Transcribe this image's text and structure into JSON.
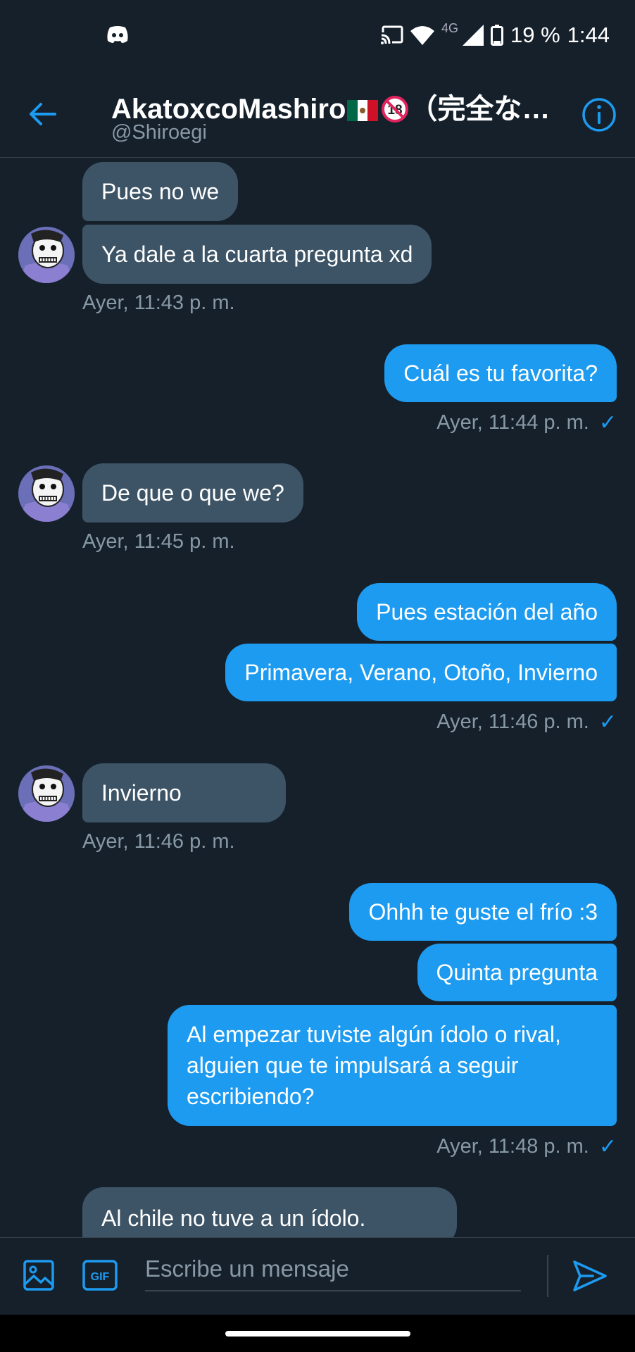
{
  "status_bar": {
    "battery": "19 %",
    "time": "1:44",
    "network": "4G"
  },
  "header": {
    "title_name": "AkatoxcoMashiro",
    "title_suffix": "（完全な…",
    "handle": "@Shiroegi"
  },
  "messages": {
    "m1": "Pues no we",
    "m2": "Ya dale a la cuarta pregunta xd",
    "t1": "Ayer, 11:43 p. m.",
    "m3": "Cuál es tu favorita?",
    "t2": "Ayer, 11:44 p. m.",
    "m4": "De que o que we?",
    "t3": "Ayer, 11:45 p. m.",
    "m5": "Pues estación del año",
    "m6": "Primavera, Verano, Otoño, Invierno",
    "t4": "Ayer, 11:46 p. m.",
    "m7": "Invierno",
    "t5": "Ayer, 11:46 p. m.",
    "m8": "Ohhh te guste el frío :3",
    "m9": "Quinta pregunta",
    "m10": "Al empezar tuviste algún ídolo o rival, alguien que te impulsará a seguir escribiendo?",
    "t6": "Ayer, 11:48 p. m.",
    "m11": "Al chile no tuve a un ídolo."
  },
  "read_check": "✓",
  "composer": {
    "placeholder": "Escribe un mensaje",
    "gif_label": "GIF"
  },
  "colors": {
    "background": "#15202b",
    "sent_bubble": "#1d9bf0",
    "received_bubble": "#3d5466",
    "accent": "#1d9bf0",
    "muted_text": "#8899a6"
  }
}
